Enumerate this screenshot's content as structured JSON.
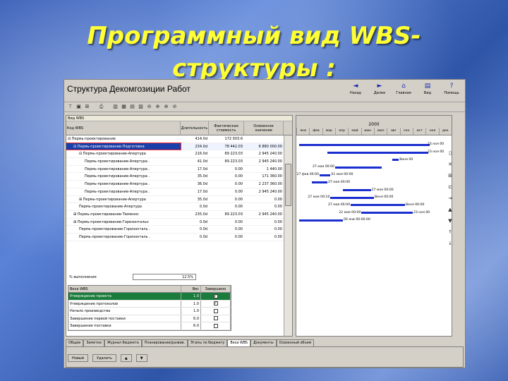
{
  "slide": {
    "title_line1": "Программный вид WBS-",
    "title_line2": "структуры :"
  },
  "window": {
    "title": "Структура Декомгозиции Работ",
    "nav": [
      {
        "label": "Назад",
        "icon": "◄"
      },
      {
        "label": "Далее",
        "icon": "►"
      },
      {
        "label": "Главная",
        "icon": "⌂"
      },
      {
        "label": "Вид",
        "icon": "▤"
      },
      {
        "label": "Помощь",
        "icon": "?"
      }
    ]
  },
  "grid": {
    "pane_label": "Вид WBS",
    "headers": {
      "name": "Код WBS",
      "duration": "Длительность",
      "cost": "Фактическая стоимость",
      "earned": "Освоенное значение"
    },
    "rows": [
      {
        "name": "⊟ Пермь-проектирование",
        "duration": "414.0d",
        "cost": "172 003.6",
        "earned": "",
        "indent": 0
      },
      {
        "name": "⊟ Пермь-проектирование-Подготовка",
        "duration": "234.0d",
        "cost": "78 442.03",
        "earned": "6 880 000.00",
        "indent": 1,
        "selected": true
      },
      {
        "name": "⊟ Пермь-проектирование-Апертура",
        "duration": "216.0d",
        "cost": "89 223.03",
        "earned": "2 945 240.00",
        "indent": 2
      },
      {
        "name": "Пермь-проектирование-Апертура .",
        "duration": "41.0d",
        "cost": "89 223.03",
        "earned": "2 945 240.00",
        "indent": 3
      },
      {
        "name": "Пермь-проектирование-Апертура .",
        "duration": "17.0d",
        "cost": "0.00",
        "earned": "1 440.00",
        "indent": 3
      },
      {
        "name": "Пермь-проектирование-Апертура .",
        "duration": "35.0d",
        "cost": "0.00",
        "earned": "171 360.00",
        "indent": 3
      },
      {
        "name": "Пермь-проектирование-Апертура .",
        "duration": "36.0d",
        "cost": "0.00",
        "earned": "2 237 360.00",
        "indent": 3
      },
      {
        "name": "Пермь-проектирование-Апертура .",
        "duration": "17.0d",
        "cost": "0.00",
        "earned": "2 945 240.00",
        "indent": 3
      },
      {
        "name": "⊞ Пермь-проектирование-Апертура",
        "duration": "35.0d",
        "cost": "0.00",
        "earned": "0.00",
        "indent": 2
      },
      {
        "name": "Пермь-проектирование-Апертура",
        "duration": "0.0d",
        "cost": "0.00",
        "earned": "0.00",
        "indent": 2
      },
      {
        "name": "⊞ Пермь-проектирование-Тюменос",
        "duration": "235.0d",
        "cost": "89 223.03",
        "earned": "2 945 240.00",
        "indent": 1
      },
      {
        "name": "⊞ Пермь-проектирование-Горизонтальн",
        "duration": "0.0d",
        "cost": "0.00",
        "earned": "0.00",
        "indent": 1
      },
      {
        "name": "Пермь-проектирование-Горизонталь .",
        "duration": "0.0d",
        "cost": "0.00",
        "earned": "0.00",
        "indent": 2
      },
      {
        "name": "Пермь-проектирование-Горизонталь .",
        "duration": "0.0d",
        "cost": "0.00",
        "earned": "0.00",
        "indent": 2
      }
    ]
  },
  "gantt": {
    "year": "2000",
    "months": [
      "янв",
      "фев",
      "мар",
      "апр",
      "май",
      "июн",
      "июл",
      "авг",
      "сен",
      "окт",
      "ноя",
      "дек"
    ],
    "bars": [
      {
        "start": 0.02,
        "end": 0.86,
        "label_left": "",
        "label_right": "23 ноя 00"
      },
      {
        "start": 0.2,
        "end": 0.85,
        "label_left": "",
        "label_right": "23 ноя 00"
      },
      {
        "start": 0.62,
        "end": 0.66,
        "label_left": "",
        "label_right": "Веня 00"
      },
      {
        "start": 0.25,
        "end": 0.55,
        "label_left": "27 мая 00:00",
        "label_right": ""
      },
      {
        "start": 0.15,
        "end": 0.22,
        "label_left": "27 фев 00:00",
        "label_right": "01 мая 00:00"
      },
      {
        "start": 0.1,
        "end": 0.2,
        "label_left": "",
        "label_right": "27 мая 00:00"
      },
      {
        "start": 0.3,
        "end": 0.48,
        "label_left": "",
        "label_right": "27 мая 00:00"
      },
      {
        "start": 0.22,
        "end": 0.5,
        "label_left": "27 мая 00:10",
        "label_right": "Веня 00:00"
      },
      {
        "start": 0.35,
        "end": 0.7,
        "label_left": "27 мая 00:00",
        "label_right": "Веня 00:00"
      },
      {
        "start": 0.42,
        "end": 0.75,
        "label_left": "22 мая 00:00",
        "label_right": "23 ноя 00"
      },
      {
        "start": 0.02,
        "end": 0.3,
        "label_left": "",
        "label_right": "00 янв 00:00:00"
      },
      {
        "start": 0,
        "end": 0,
        "label_left": "",
        "label_right": ""
      },
      {
        "start": 0,
        "end": 0,
        "label_left": "",
        "label_right": ""
      },
      {
        "start": 0,
        "end": 0,
        "label_left": "",
        "label_right": ""
      }
    ]
  },
  "tabs": [
    "Общие",
    "Заметки",
    "Журнал бюджета",
    "Планирование/развив.",
    "Этапы по бюджету",
    "Веха WBS",
    "Документы",
    "Освоенный объем"
  ],
  "steps": {
    "progress_label": "% выполнения",
    "progress_value": "12.5%",
    "headers": {
      "name": "Веха WBS",
      "weight": "Вес",
      "done": "Завершено"
    },
    "rows": [
      {
        "name": "Утверждение проекта",
        "weight": "1.0",
        "done": true,
        "selected": true
      },
      {
        "name": "Утверждение протоколов",
        "weight": "1.0",
        "done": true
      },
      {
        "name": "Начало производства",
        "weight": "1.0",
        "done": false
      },
      {
        "name": "Завершение первой поставки",
        "weight": "6.0",
        "done": false
      },
      {
        "name": "Завершение поставки",
        "weight": "6.0",
        "done": false
      }
    ]
  },
  "buttons": {
    "add": "Новый",
    "delete": "Удалить",
    "up": "▲",
    "down": "▼"
  }
}
